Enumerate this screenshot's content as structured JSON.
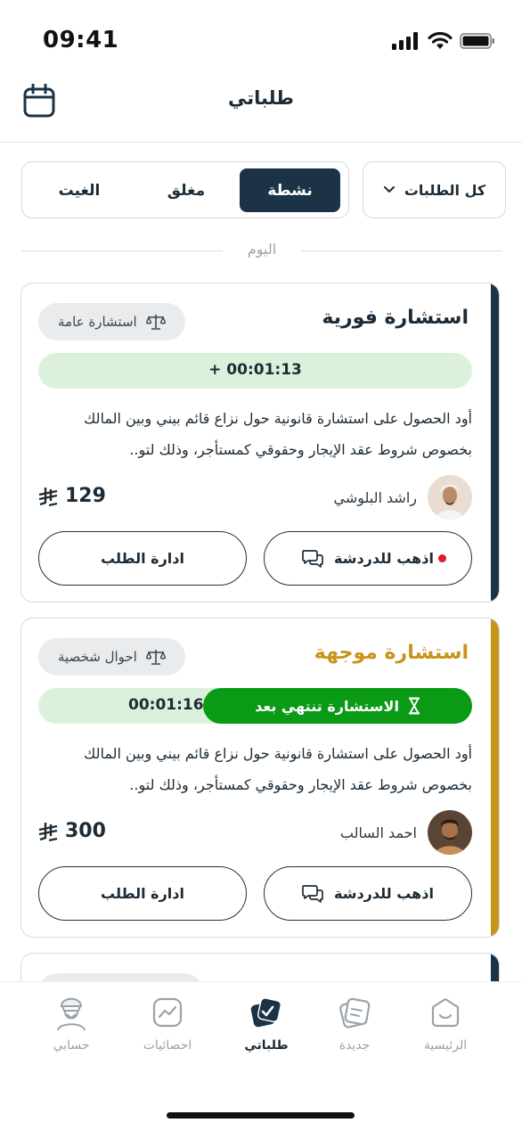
{
  "status_bar": {
    "time": "09:41"
  },
  "header": {
    "title": "طلباتي"
  },
  "filters": {
    "tabs": [
      {
        "label": "نشطة"
      },
      {
        "label": "مغلق"
      },
      {
        "label": "الغيت"
      }
    ],
    "dropdown_label": "كل الطلبات"
  },
  "day_label": "اليوم",
  "cards": [
    {
      "title": "استشارة فورية",
      "title_color": "#1c2b36",
      "accent_color": "#1c3347",
      "category": "استشارة عامة",
      "timer": "+ 00:01:13",
      "description": "أود الحصول على استشارة قانونية حول نزاع قائم بيني وبين المالك بخصوص شروط عقد الإيجار وحقوقي كمستأجر، وذلك لتو..",
      "client_name": "راشد البلوشي",
      "price": "129",
      "chat_label": "اذهب للدردشة",
      "manage_label": "ادارة الطلب",
      "has_unread": true
    },
    {
      "title": "استشارة موجهة",
      "title_color": "#c89419",
      "accent_color": "#c89419",
      "category": "احوال شخصية",
      "timer": "00:01:16",
      "timer_pill": "الاستشارة تنتهي بعد",
      "description": "أود الحصول على استشارة قانونية حول نزاع قائم بيني وبين المالك بخصوص شروط عقد الإيجار وحقوقي كمستأجر، وذلك لتو..",
      "client_name": "احمد السالب",
      "price": "300",
      "chat_label": "اذهب للدردشة",
      "manage_label": "ادارة الطلب",
      "has_unread": false
    }
  ],
  "bottom_nav": [
    {
      "label": "الرئيسية",
      "icon": "home-icon"
    },
    {
      "label": "جديدة",
      "icon": "new-requests-icon"
    },
    {
      "label": "طلباتي",
      "icon": "my-requests-icon",
      "active": true
    },
    {
      "label": "احصائيات",
      "icon": "stats-icon"
    },
    {
      "label": "حسابي",
      "icon": "profile-icon"
    }
  ],
  "colors": {
    "primary": "#1c3347",
    "timer_green_light": "#dcf1dc",
    "timer_green": "#0a9a16",
    "gold": "#c89419",
    "unread_red": "#e0192b"
  }
}
